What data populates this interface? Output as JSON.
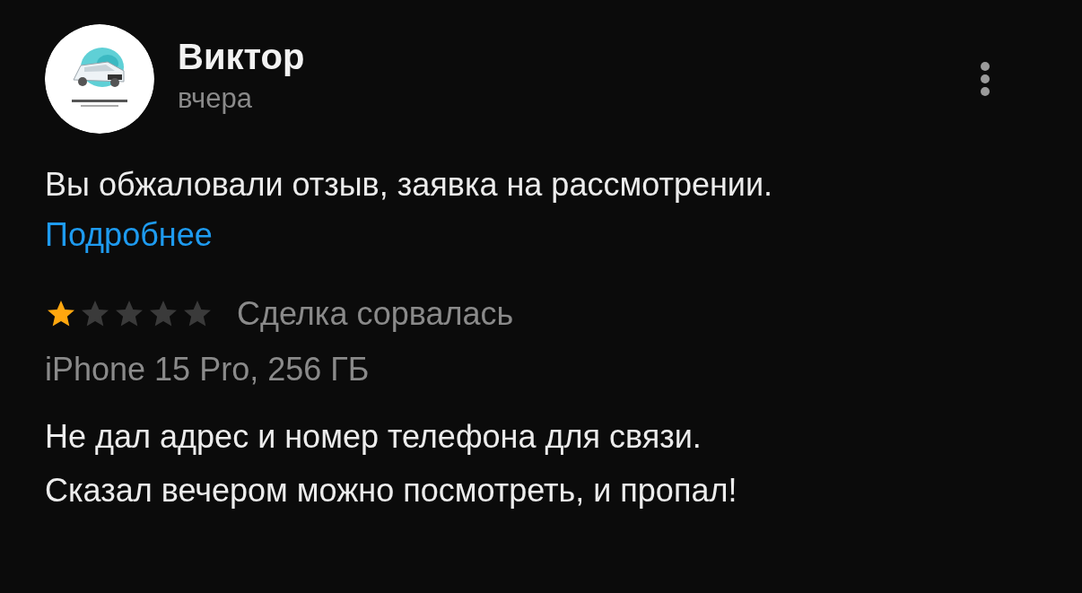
{
  "review": {
    "author": "Виктор",
    "time": "вчера",
    "notice": "Вы обжаловали отзыв, заявка на рассмотрении.",
    "notice_link": "Подробнее",
    "stars": 1,
    "outcome": "Сделка сорвалась",
    "product": "iPhone 15 Pro, 256 ГБ",
    "text_lines": [
      "Не дал адрес и номер телефона для связи.",
      "Сказал вечером можно посмотреть, и пропал!"
    ]
  }
}
